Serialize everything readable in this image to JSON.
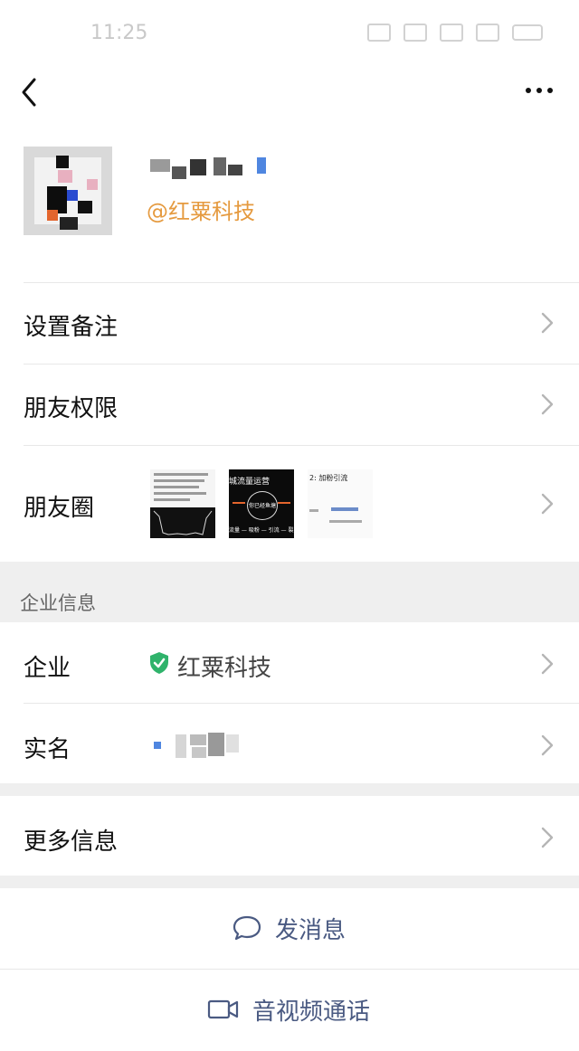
{
  "status_bar": {
    "time": "11:25"
  },
  "profile": {
    "company_tag": "@红粟科技"
  },
  "rows": {
    "remark": "设置备注",
    "permissions": "朋友权限",
    "moments": "朋友圈"
  },
  "moments_previews": {
    "thumb2_headline": "城流量运营",
    "thumb2_center": "你已经鱼塘",
    "thumb2_bottom": "流量 — 吸粉 — 引流 — 裂变",
    "thumb3_title": "2: 加粉引流"
  },
  "enterprise": {
    "section_title": "企业信息",
    "company_label": "企业",
    "company_name": "红粟科技",
    "realname_label": "实名"
  },
  "more_info": "更多信息",
  "actions": {
    "send_message": "发消息",
    "av_call": "音视频通话"
  },
  "colors": {
    "accent_tag": "#e59a3f",
    "verified_green": "#2fb36b",
    "action_text": "#4a5a82",
    "section_bg": "#efefef"
  },
  "icons": {
    "back": "chevron-left-icon",
    "more": "more-horizontal-icon",
    "row_arrow": "chevron-right-icon",
    "verified": "verified-shield-icon",
    "message": "chat-bubble-icon",
    "video": "video-camera-icon"
  }
}
